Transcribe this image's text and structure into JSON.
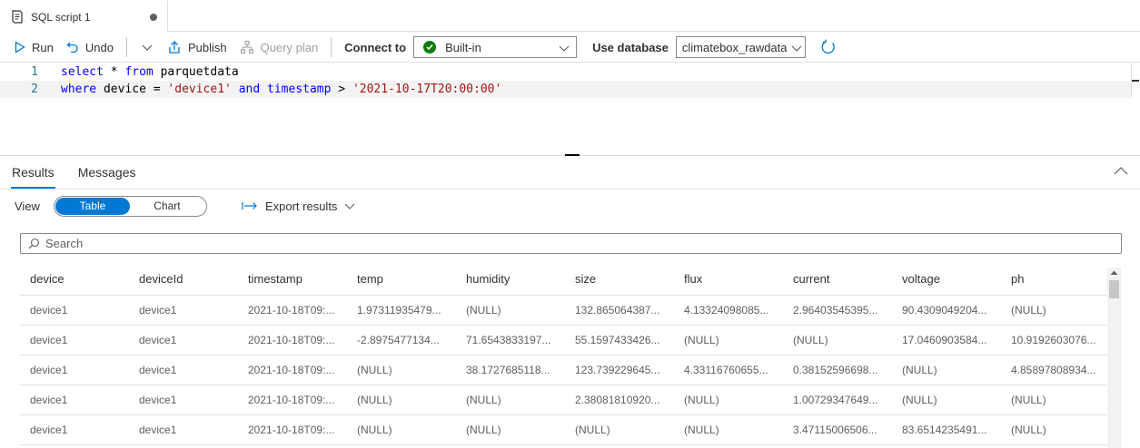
{
  "tab": {
    "title": "SQL script 1"
  },
  "toolbar": {
    "run": "Run",
    "undo": "Undo",
    "publish": "Publish",
    "query_plan": "Query plan",
    "connect_to_label": "Connect to",
    "connect_to_value": "Built-in",
    "use_database_label": "Use database",
    "use_database_value": "climatebox_rawdata"
  },
  "editor": {
    "lines": [
      {
        "no": "1",
        "tokens": [
          {
            "t": "select",
            "c": "kw"
          },
          {
            "t": " * ",
            "c": "ident"
          },
          {
            "t": "from",
            "c": "kw"
          },
          {
            "t": " parquetdata",
            "c": "ident"
          }
        ]
      },
      {
        "no": "2",
        "tokens": [
          {
            "t": "where",
            "c": "kw"
          },
          {
            "t": " device = ",
            "c": "ident"
          },
          {
            "t": "'device1'",
            "c": "str"
          },
          {
            "t": " ",
            "c": "ident"
          },
          {
            "t": "and",
            "c": "kw"
          },
          {
            "t": " ",
            "c": "ident"
          },
          {
            "t": "timestamp",
            "c": "kw"
          },
          {
            "t": " > ",
            "c": "ident"
          },
          {
            "t": "'2021-10-17T20:00:00'",
            "c": "str"
          }
        ]
      }
    ]
  },
  "results": {
    "tabs": [
      "Results",
      "Messages"
    ],
    "view_label": "View",
    "view_options": [
      "Table",
      "Chart"
    ],
    "export_label": "Export results",
    "search_placeholder": "Search",
    "columns": [
      "device",
      "deviceId",
      "timestamp",
      "temp",
      "humidity",
      "size",
      "flux",
      "current",
      "voltage",
      "ph"
    ],
    "rows": [
      [
        "device1",
        "device1",
        "2021-10-18T09:...",
        "1.97311935479...",
        "(NULL)",
        "132.865064387...",
        "4.13324098085...",
        "2.96403545395...",
        "90.4309049204...",
        "(NULL)"
      ],
      [
        "device1",
        "device1",
        "2021-10-18T09:...",
        "-2.8975477134...",
        "71.6543833197...",
        "55.1597433426...",
        "(NULL)",
        "(NULL)",
        "17.0460903584...",
        "10.9192603076..."
      ],
      [
        "device1",
        "device1",
        "2021-10-18T09:...",
        "(NULL)",
        "38.1727685118...",
        "123.739229645...",
        "4.33116760655...",
        "0.38152596698...",
        "(NULL)",
        "4.85897808934..."
      ],
      [
        "device1",
        "device1",
        "2021-10-18T09:...",
        "(NULL)",
        "(NULL)",
        "2.38081810920...",
        "(NULL)",
        "1.00729347649...",
        "(NULL)",
        "(NULL)"
      ],
      [
        "device1",
        "device1",
        "2021-10-18T09:...",
        "(NULL)",
        "(NULL)",
        "(NULL)",
        "(NULL)",
        "3.47115006506...",
        "83.6514235491...",
        "(NULL)"
      ]
    ]
  },
  "colors": {
    "accent": "#0078d4",
    "ok": "#107c10",
    "keyword": "#0000ff",
    "string": "#a31515",
    "line_number": "#237893"
  }
}
